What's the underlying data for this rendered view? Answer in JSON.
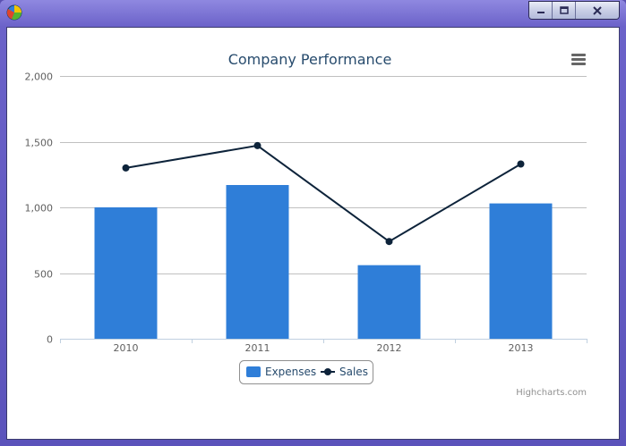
{
  "window": {
    "icon": "pie-chart-icon",
    "controls": [
      "minimize-icon",
      "maximize-icon",
      "close-icon"
    ]
  },
  "chart_data": {
    "type": "bar",
    "title": "Company Performance",
    "categories": [
      "2010",
      "2011",
      "2012",
      "2013"
    ],
    "series": [
      {
        "name": "Expenses",
        "type": "bar",
        "color": "#2f7ed8",
        "values": [
          1000,
          1170,
          560,
          1030
        ]
      },
      {
        "name": "Sales",
        "type": "line",
        "color": "#0d233a",
        "values": [
          1300,
          1470,
          740,
          1330
        ]
      }
    ],
    "y_ticks": [
      "0",
      "500",
      "1,000",
      "1,500",
      "2,000"
    ],
    "ylim": [
      0,
      2000
    ],
    "grid": true,
    "legend_position": "bottom-center",
    "credits": "Highcharts.com"
  },
  "menu": {
    "icon": "hamburger-menu-icon"
  }
}
